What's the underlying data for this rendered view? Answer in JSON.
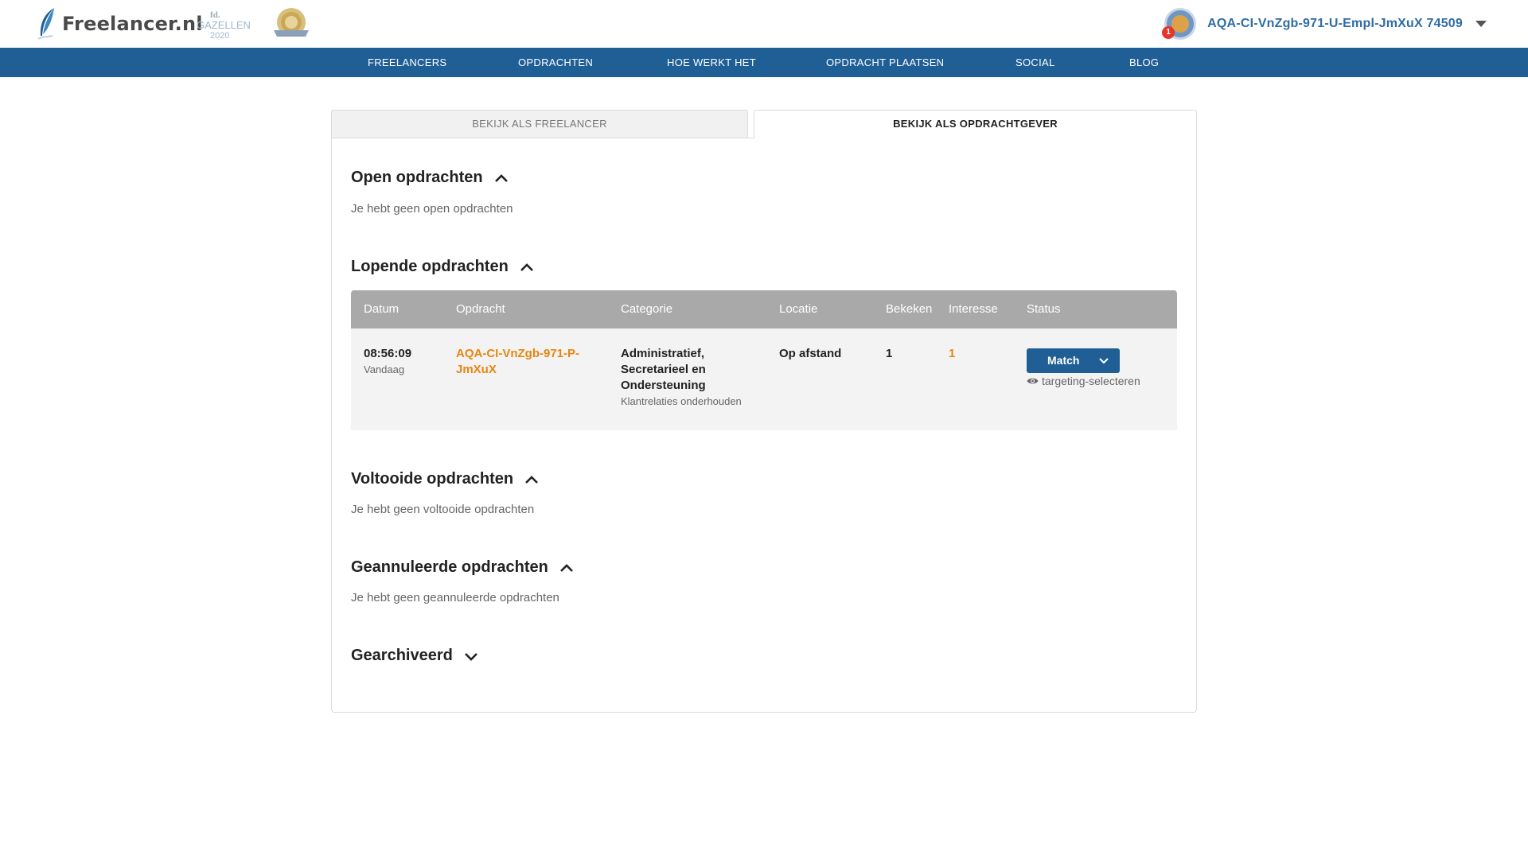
{
  "header": {
    "logo_text": "Freelancer.nl",
    "badge_gazellen_top": "fd.",
    "badge_gazellen_word": "GAZELLEN",
    "badge_gazellen_year": "2020",
    "username": "AQA-CI-VnZgb-971-U-Empl-JmXuX 74509",
    "notification_count": "1"
  },
  "nav": {
    "items": [
      {
        "label": "FREELANCERS"
      },
      {
        "label": "OPDRACHTEN"
      },
      {
        "label": "HOE WERKT HET"
      },
      {
        "label": "OPDRACHT PLAATSEN"
      },
      {
        "label": "SOCIAL"
      },
      {
        "label": "BLOG"
      }
    ]
  },
  "tabs": {
    "freelancer": "BEKIJK ALS FREELANCER",
    "opdrachtgever": "BEKIJK ALS OPDRACHTGEVER",
    "active": "opdrachtgever"
  },
  "sections": {
    "open": {
      "title": "Open opdrachten",
      "empty": "Je hebt geen open opdrachten",
      "expanded": true
    },
    "lopende": {
      "title": "Lopende opdrachten",
      "expanded": true
    },
    "voltooide": {
      "title": "Voltooide opdrachten",
      "empty": "Je hebt geen voltooide opdrachten",
      "expanded": true
    },
    "geannuleerde": {
      "title": "Geannuleerde opdrachten",
      "empty": "Je hebt geen geannuleerde opdrachten",
      "expanded": true
    },
    "gearchiveerd": {
      "title": "Gearchiveerd",
      "expanded": false
    }
  },
  "table": {
    "columns": [
      "Datum",
      "Opdracht",
      "Categorie",
      "Locatie",
      "Bekeken",
      "Interesse",
      "Status"
    ],
    "rows": [
      {
        "time": "08:56:09",
        "day": "Vandaag",
        "opdracht_line1": "AQA-CI-VnZgb-971-P-",
        "opdracht_line2": "JmXuX",
        "categorie_line1": "Administratief,",
        "categorie_line2": "Secretarieel en",
        "categorie_line3": "Ondersteuning",
        "subcategorie": "Klantrelaties onderhouden",
        "locatie": "Op afstand",
        "bekeken": "1",
        "interesse": "1",
        "status_button": "Match",
        "status_note": "targeting-selecteren"
      }
    ]
  },
  "colors": {
    "brand_blue": "#1f5f96",
    "accent_orange": "#e8850f",
    "table_header": "#a9a9a9"
  },
  "icons": {
    "logo": "feather-icon",
    "user_menu": "caret-down-icon",
    "section_toggle": "chevron-icon",
    "status_dropdown": "chevron-down-icon",
    "targeting": "eye-icon"
  }
}
